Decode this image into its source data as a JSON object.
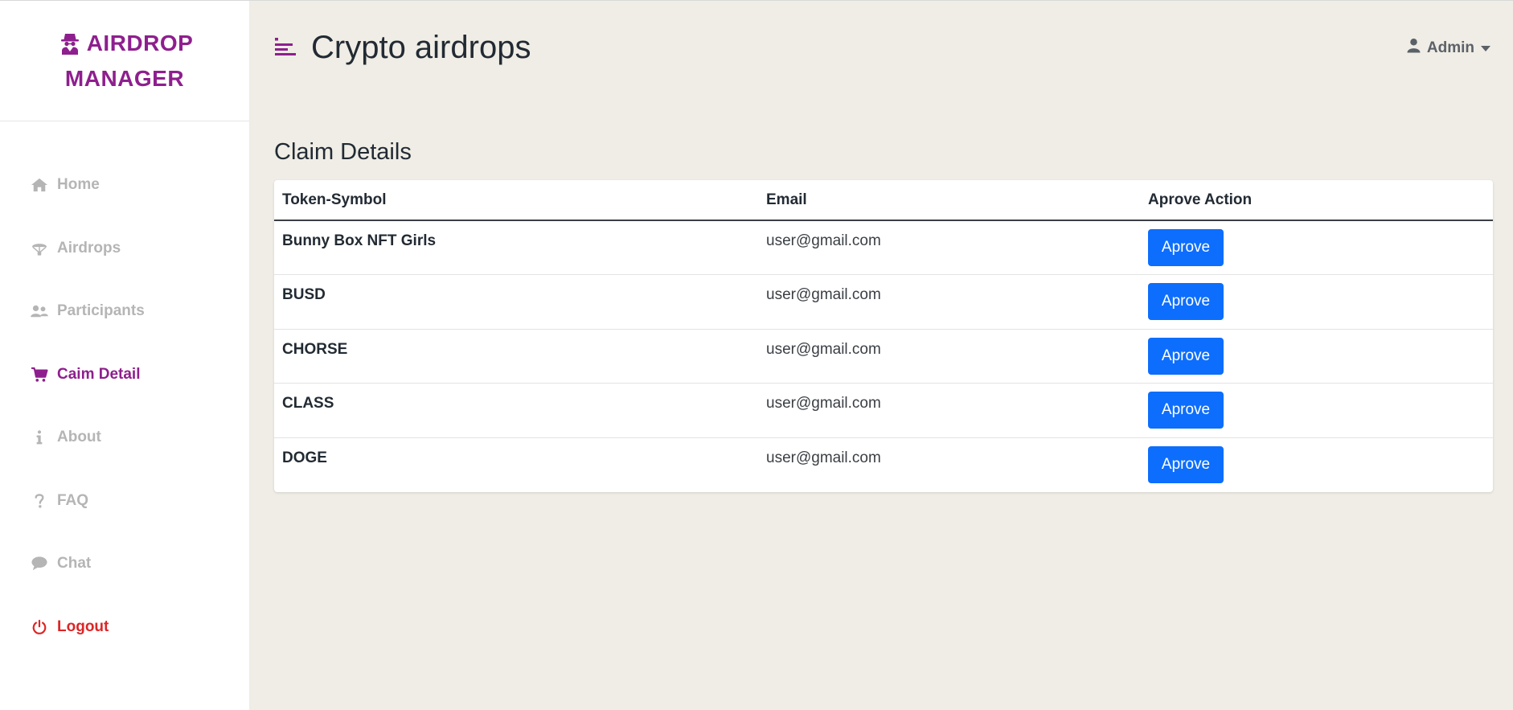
{
  "brand": {
    "line1": "AIRDROP",
    "line2": "MANAGER",
    "icon": "user-secret-icon"
  },
  "sidebar": {
    "items": [
      {
        "label": "Home",
        "icon": "home-icon",
        "state": "default"
      },
      {
        "label": "Airdrops",
        "icon": "parachute-icon",
        "state": "default"
      },
      {
        "label": "Participants",
        "icon": "users-icon",
        "state": "default"
      },
      {
        "label": "Caim Detail",
        "icon": "cart-icon",
        "state": "active"
      },
      {
        "label": "About",
        "icon": "info-icon",
        "state": "default"
      },
      {
        "label": "FAQ",
        "icon": "question-icon",
        "state": "default"
      },
      {
        "label": "Chat",
        "icon": "chat-icon",
        "state": "default"
      },
      {
        "label": "Logout",
        "icon": "power-icon",
        "state": "danger"
      }
    ]
  },
  "header": {
    "title": "Crypto airdrops",
    "user_label": "Admin"
  },
  "main": {
    "section_title": "Claim Details",
    "table": {
      "columns": [
        "Token-Symbol",
        "Email",
        "Aprove Action"
      ],
      "rows": [
        {
          "token": "Bunny Box NFT Girls",
          "email": "user@gmail.com",
          "action": "Aprove"
        },
        {
          "token": "BUSD",
          "email": "user@gmail.com",
          "action": "Aprove"
        },
        {
          "token": "CHORSE",
          "email": "user@gmail.com",
          "action": "Aprove"
        },
        {
          "token": "CLASS",
          "email": "user@gmail.com",
          "action": "Aprove"
        },
        {
          "token": "DOGE",
          "email": "user@gmail.com",
          "action": "Aprove"
        }
      ]
    }
  },
  "colors": {
    "brand": "#8e1f8e",
    "nav_inactive": "#b5b5b5",
    "logout": "#dc2626",
    "main_bg": "#efede5",
    "button": "#0d6efd"
  }
}
